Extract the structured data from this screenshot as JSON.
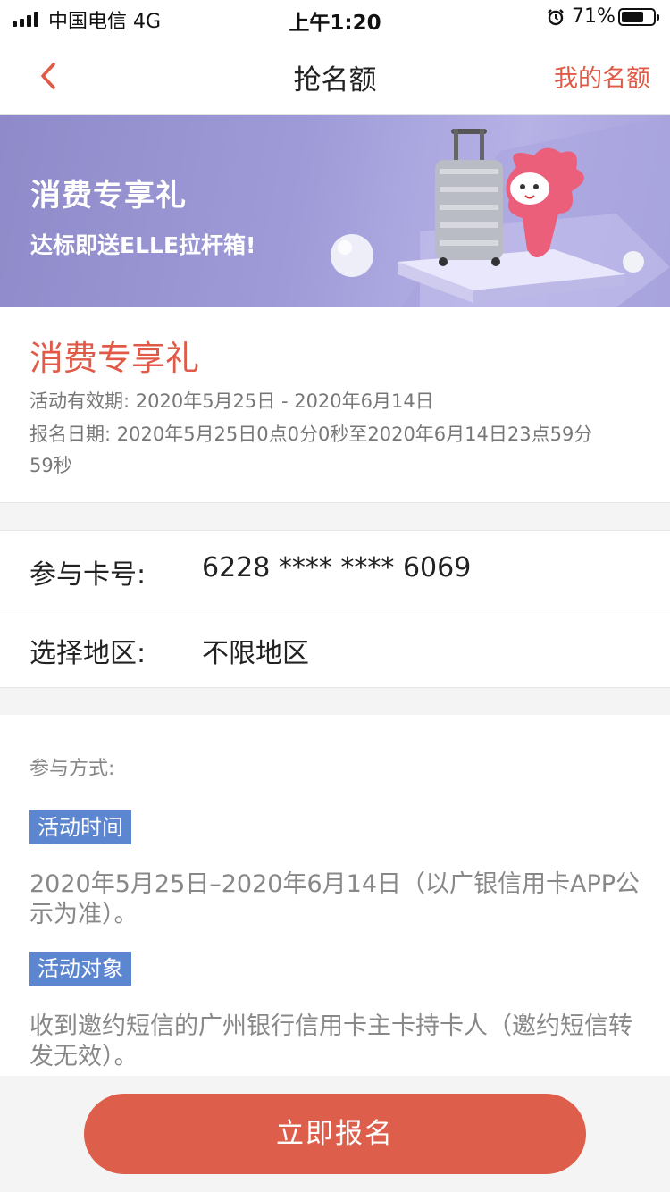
{
  "status_bar": {
    "carrier": "中国电信  4G",
    "time": "上午1:20",
    "battery": "71%",
    "battery_level": 0.71
  },
  "nav": {
    "title": "抢名额",
    "right_link": "我的名额"
  },
  "banner": {
    "title": "消费专享礼",
    "subtitle": "达标即送ELLE拉杆箱!"
  },
  "activity": {
    "title": "消费专享礼",
    "valid_period": "活动有效期: 2020年5月25日 - 2020年6月14日",
    "signup_date_line1": "报名日期: 2020年5月25日0点0分0秒至2020年6月14日23点59分",
    "signup_date_line2": "59秒"
  },
  "form": {
    "card_label": "参与卡号:",
    "card_value": "6228 **** **** 6069",
    "region_label": "选择地区:",
    "region_value": "不限地区"
  },
  "participation": {
    "heading": "参与方式:",
    "sections": [
      {
        "tag": "活动时间",
        "text": "2020年5月25日–2020年6月14日（以广银信用卡APP公示为准）。"
      },
      {
        "tag": "活动对象",
        "text": "收到邀约短信的广州银行信用卡主卡持卡人（邀约短信转发无效）。"
      }
    ]
  },
  "cta": {
    "label": "立即报名"
  },
  "colors": {
    "accent": "#e05a47",
    "button": "#dd5f4b",
    "tag": "#5d86d1",
    "banner": "#9f9bd8"
  }
}
